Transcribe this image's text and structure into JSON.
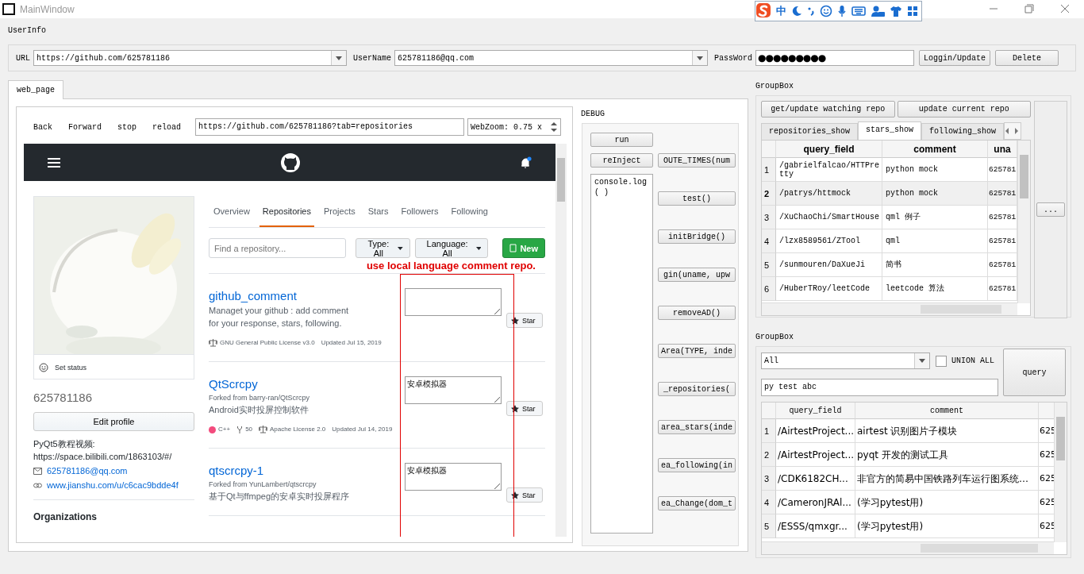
{
  "window": {
    "title": "MainWindow"
  },
  "ime_toolbar": {
    "mode": "中"
  },
  "user_info": {
    "title": "UserInfo",
    "fields": [
      {
        "kind": "combo",
        "label": "URL",
        "value": "https://github.com/625781186"
      },
      {
        "kind": "combo",
        "label": "UserName",
        "value": "625781186@qq.com"
      },
      {
        "kind": "password",
        "label": "PassWord",
        "value": "●●●●●●●●●"
      }
    ],
    "buttons": [
      "Loggin/Update",
      "Delete"
    ]
  },
  "tabs": [
    {
      "label": "web_page",
      "selected": true
    }
  ],
  "browser": {
    "nav_buttons": [
      "Back",
      "Forward",
      "stop",
      "reload"
    ],
    "address": "https://github.com/625781186?tab=repositories",
    "zoom": "WebZoom: 0.75 x"
  },
  "github": {
    "profile": {
      "status": "Set status",
      "username": "625781186",
      "edit_button": "Edit profile",
      "bio": "PyQt5教程视频: https://space.bilibili.com/1863103/#/",
      "email": "625781186@qq.com",
      "website": "www.jianshu.com/u/c6cac9bdde4f",
      "organizations_heading": "Organizations"
    },
    "nav": [
      {
        "label": "Overview",
        "selected": false
      },
      {
        "label": "Repositories",
        "selected": true
      },
      {
        "label": "Projects",
        "selected": false
      },
      {
        "label": "Stars",
        "selected": false
      },
      {
        "label": "Followers",
        "selected": false
      },
      {
        "label": "Following",
        "selected": false
      }
    ],
    "search": {
      "placeholder": "Find a repository..."
    },
    "filters": [
      "Type: All",
      "Language: All"
    ],
    "new_button": "New",
    "annotation": "use local language comment repo.",
    "repos": [
      {
        "name": "github_comment",
        "description": "Managet your github : add comment for your response, stars, following.",
        "license": "GNU General Public License v3.0",
        "updated": "Updated Jul 15, 2019",
        "star_button": "Star"
      },
      {
        "name": "QtScrcpy",
        "forked_from": "Forked from barry-ran/QtScrcpy",
        "description": "Android实时投屏控制软件",
        "language": "C++",
        "color": "#f34b7d",
        "forks": "50",
        "license": "Apache License 2.0",
        "updated": "Updated Jul 14, 2019",
        "comment": "安卓模拟器",
        "star_button": "Star"
      },
      {
        "name": "qtscrcpy-1",
        "forked_from": "Forked from YunLambert/qtscrcpy",
        "description": "基于Qt与ffmpeg的安卓实时投屏程序",
        "comment": "安卓模拟器",
        "star_button": "Star"
      }
    ]
  },
  "debug": {
    "title": "DEBUG",
    "buttons": [
      "run",
      "reInject"
    ],
    "console": "console.log ( )",
    "functions": [
      "OUTE_TIMES(num",
      "test()",
      "initBridge()",
      "gin(uname, upw",
      "removeAD()",
      "Area(TYPE, inde",
      "_repositories(",
      "area_stars(inde",
      "ea_following(in",
      "ea_Change(dom_t"
    ]
  },
  "repo_group": {
    "title": "GroupBox",
    "buttons": [
      "get/update watching repo",
      "update current repo"
    ],
    "tabs": [
      {
        "label": "repositories_show",
        "selected": false
      },
      {
        "label": "stars_show",
        "selected": true
      },
      {
        "label": "following_show",
        "selected": false
      }
    ],
    "table": {
      "columns": [
        "query_field",
        "comment",
        "una"
      ],
      "rows": [
        {
          "number": "1",
          "selected": false,
          "cells": [
            "/gabrielfalcao/HTTPretty",
            "python mock",
            "625781"
          ]
        },
        {
          "number": "2",
          "selected": true,
          "cells": [
            "/patrys/httmock",
            "python mock",
            "625781"
          ]
        },
        {
          "number": "3",
          "selected": false,
          "cells": [
            "/XuChaoChi/SmartHouse",
            "qml 例子",
            "625781"
          ]
        },
        {
          "number": "4",
          "selected": false,
          "cells": [
            "/lzx8589561/ZTool",
            "qml",
            "625781"
          ]
        },
        {
          "number": "5",
          "selected": false,
          "cells": [
            "/sunmouren/DaXueJi",
            "简书",
            "625781"
          ]
        },
        {
          "number": "6",
          "selected": false,
          "cells": [
            "/HuberTRoy/leetCode",
            "leetcode 算法",
            "625781"
          ]
        }
      ]
    },
    "side_button": "..."
  },
  "query_group": {
    "title": "GroupBox",
    "scope": "All",
    "union_all": {
      "label": "UNION ALL",
      "checked": false
    },
    "search": "py test abc",
    "query_button": "query",
    "table": {
      "columns": [
        "query_field",
        "comment"
      ],
      "rows": [
        {
          "number": "1",
          "cells": [
            "/AirtestProject...",
            "airtest 识别图片子模块",
            "625"
          ]
        },
        {
          "number": "2",
          "cells": [
            "/AirtestProject...",
            "pyqt 开发的测试工具",
            "625"
          ]
        },
        {
          "number": "3",
          "cells": [
            "/CDK6182CH...",
            "非官方的简易中国铁路列车运行图系统…",
            "625"
          ]
        },
        {
          "number": "4",
          "cells": [
            "/CameronJRAl...",
            "(学习pytest用)",
            "625"
          ]
        },
        {
          "number": "5",
          "cells": [
            "/ESSS/qmxgr...",
            "(学习pytest用)",
            "625"
          ]
        }
      ]
    }
  }
}
